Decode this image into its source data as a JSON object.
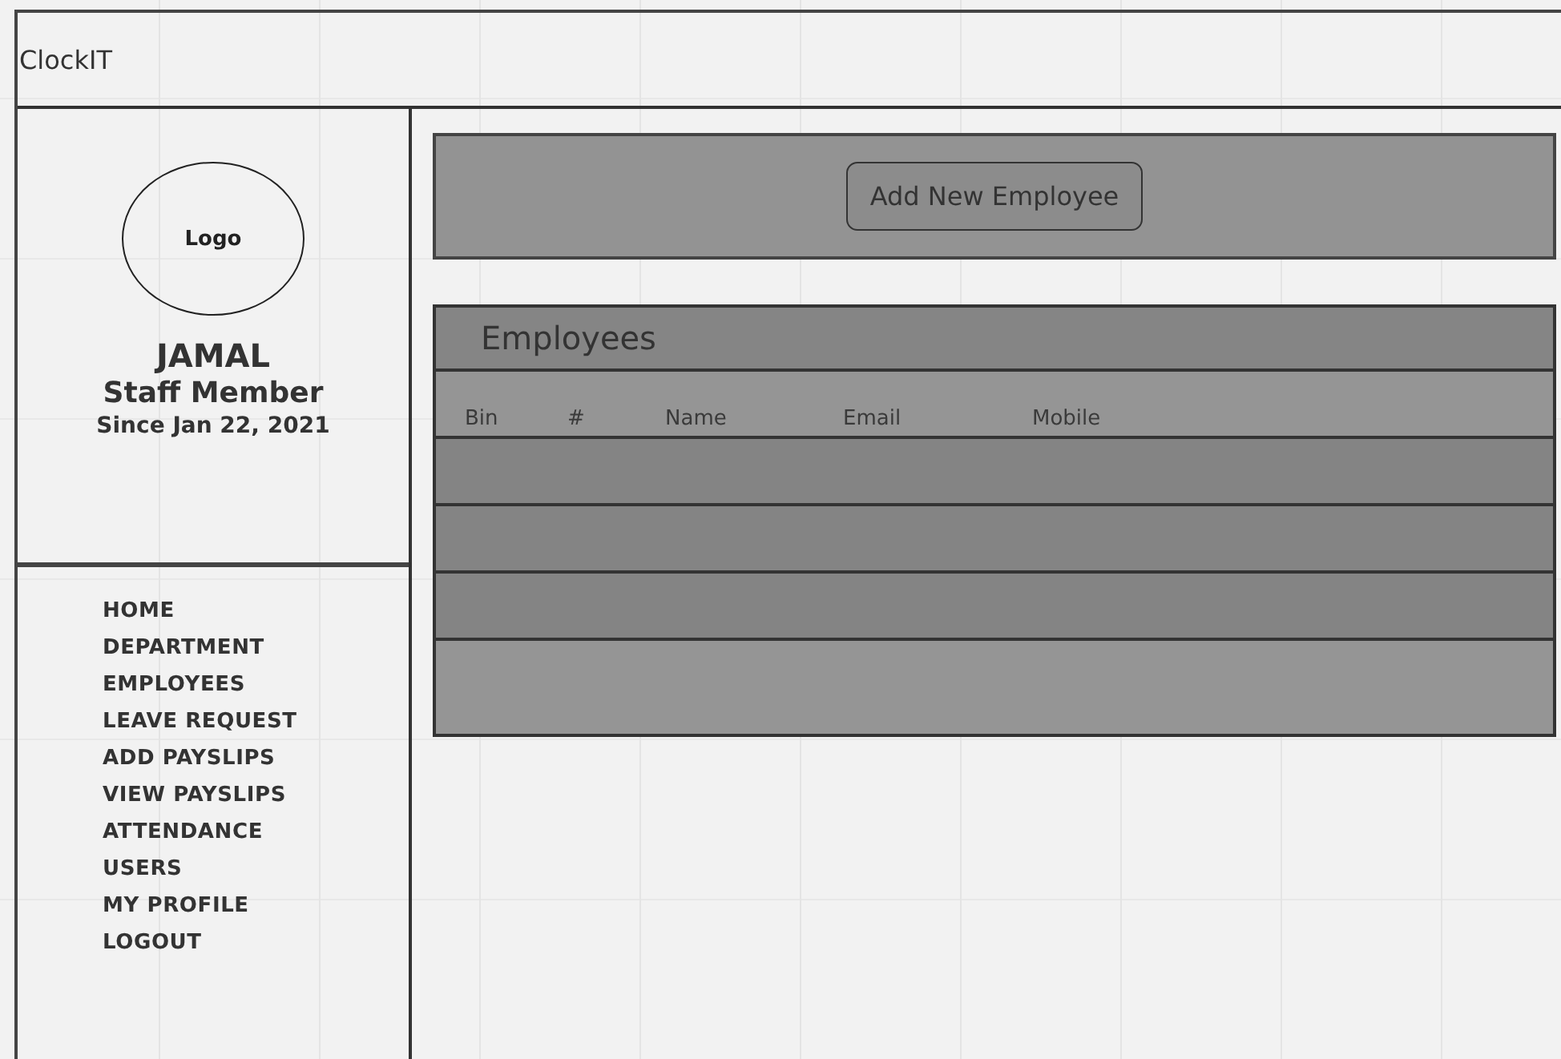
{
  "app": {
    "title": "ClockIT"
  },
  "profile": {
    "logo": "Logo",
    "name": "JAMAL",
    "role": "Staff Member",
    "since": "Since Jan 22, 2021"
  },
  "nav": {
    "items": [
      {
        "label": "HOME"
      },
      {
        "label": "DEPARTMENT"
      },
      {
        "label": "EMPLOYEES"
      },
      {
        "label": "LEAVE REQUEST"
      },
      {
        "label": "ADD PAYSLIPS"
      },
      {
        "label": "VIEW PAYSLIPS"
      },
      {
        "label": "ATTENDANCE"
      },
      {
        "label": "USERS"
      },
      {
        "label": "MY PROFILE"
      },
      {
        "label": "LOGOUT"
      }
    ]
  },
  "actions": {
    "button": "Add New Employee"
  },
  "table": {
    "title": "Employees",
    "columns": [
      "Bin",
      "#",
      "Name",
      "Email",
      "Mobile"
    ],
    "rows": [
      {
        "kind": "blank"
      },
      {
        "kind": "blank"
      },
      {
        "kind": "blank"
      }
    ]
  }
}
